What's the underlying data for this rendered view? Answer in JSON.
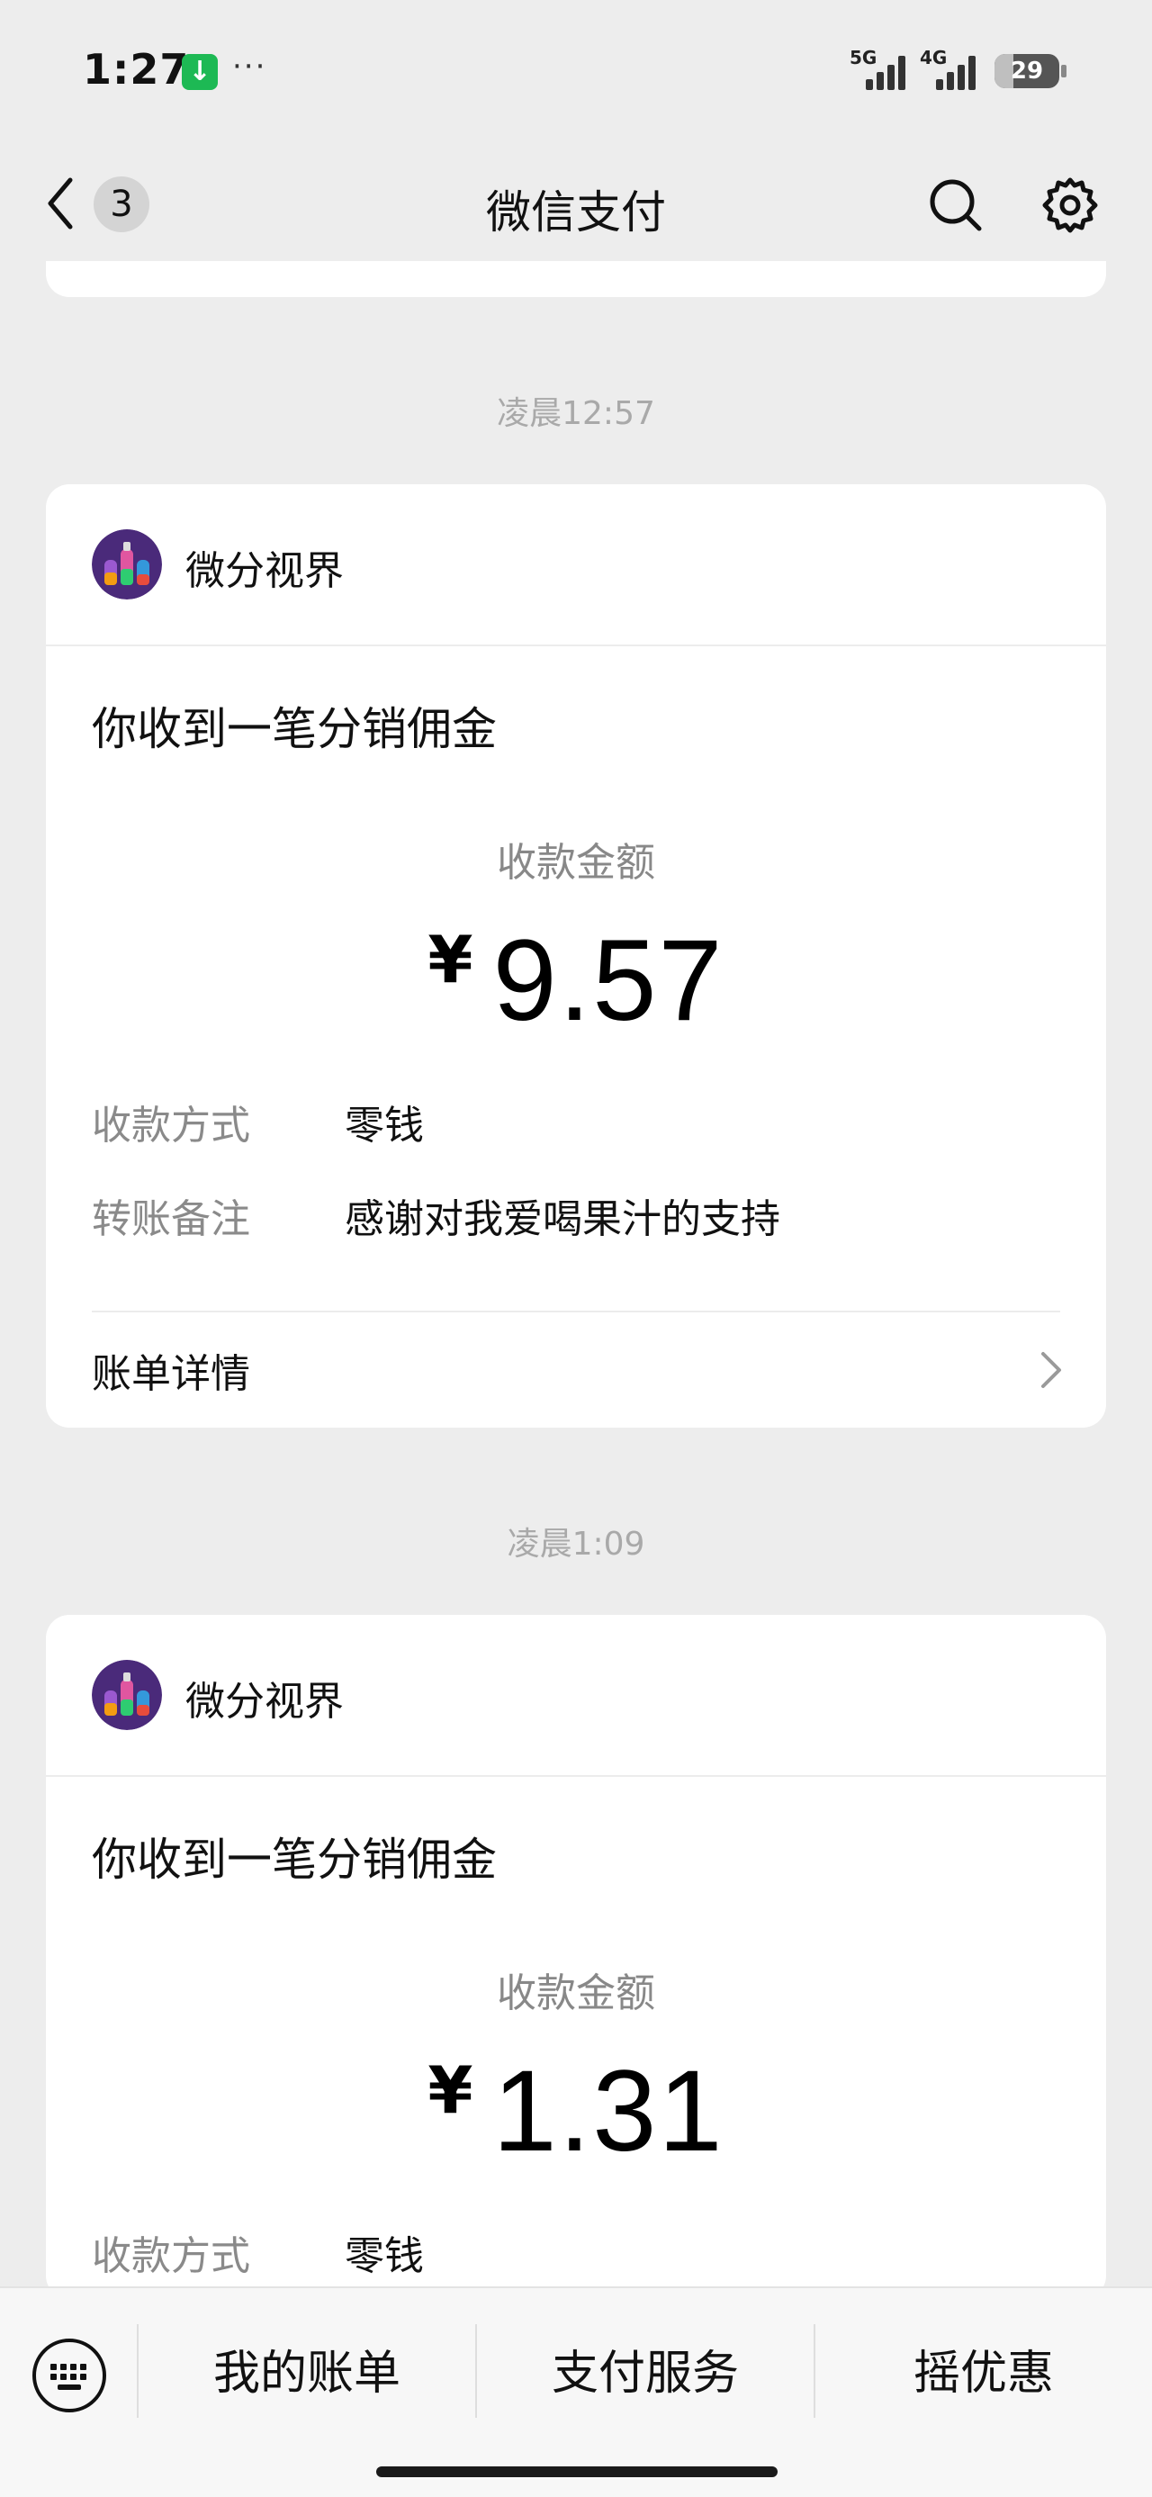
{
  "status_bar": {
    "time": "1:27",
    "network1": "5G",
    "network2": "4G",
    "battery": 29,
    "battery_text": "29"
  },
  "nav": {
    "unread_count": "3",
    "title": "微信支付"
  },
  "messages": [
    {
      "timestamp": "凌晨12:57",
      "merchant": "微分视界",
      "notice": "你收到一笔分销佣金",
      "amount_label": "收款金额",
      "currency": "¥",
      "amount": "9.57",
      "rows": [
        {
          "label": "收款方式",
          "value": "零钱"
        },
        {
          "label": "转账备注",
          "value": "感谢对我爱喝果汁的支持"
        }
      ],
      "detail_label": "账单详情"
    },
    {
      "timestamp": "凌晨1:09",
      "merchant": "微分视界",
      "notice": "你收到一笔分销佣金",
      "amount_label": "收款金额",
      "currency": "¥",
      "amount": "1.31",
      "rows": [
        {
          "label": "收款方式",
          "value": "零钱"
        }
      ]
    }
  ],
  "bottom_menu": {
    "items": [
      "我的账单",
      "支付服务",
      "摇优惠"
    ]
  },
  "colors": {
    "background": "#ededed",
    "card": "#ffffff",
    "download_badge": "#1db954"
  },
  "icons": [
    "download-icon",
    "back-chevron-icon",
    "search-icon",
    "gear-icon",
    "keyboard-icon",
    "chevron-right-icon"
  ]
}
